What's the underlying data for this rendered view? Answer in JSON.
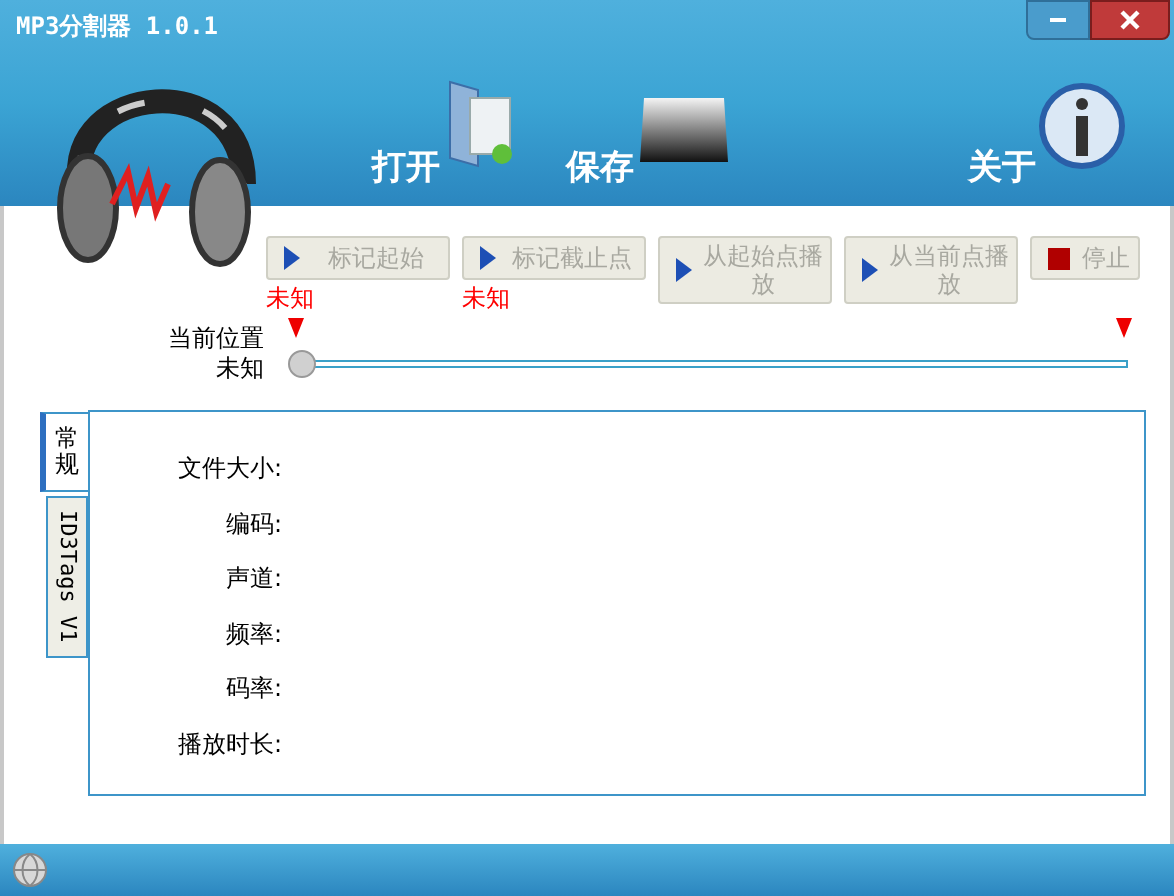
{
  "window": {
    "title": "MP3分割器 1.0.1"
  },
  "toolbar": [
    {
      "label": "打开"
    },
    {
      "label": "保存"
    },
    {
      "label": "关于"
    }
  ],
  "actions": [
    {
      "label": "标记起始",
      "kind": "play",
      "disabled": true,
      "status": "未知"
    },
    {
      "label": "标记截止点",
      "kind": "play",
      "disabled": true,
      "status": "未知"
    },
    {
      "label": "从起始点播放",
      "kind": "play",
      "disabled": true
    },
    {
      "label": "从当前点播放",
      "kind": "play",
      "disabled": true
    },
    {
      "label": "停止",
      "kind": "stop",
      "disabled": true
    }
  ],
  "position": {
    "label": "当前位置",
    "value": "未知",
    "level": 0
  },
  "tabs": [
    {
      "label": "常规",
      "selected": true,
      "kind": "cjk"
    },
    {
      "label": "ID3Tags V1",
      "selected": false,
      "kind": "latin"
    }
  ],
  "fields": [
    {
      "label": "文件大小:"
    },
    {
      "label": "编码:"
    },
    {
      "label": "声道:"
    },
    {
      "label": "频率:"
    },
    {
      "label": "码率:"
    },
    {
      "label": "播放时长:"
    }
  ]
}
